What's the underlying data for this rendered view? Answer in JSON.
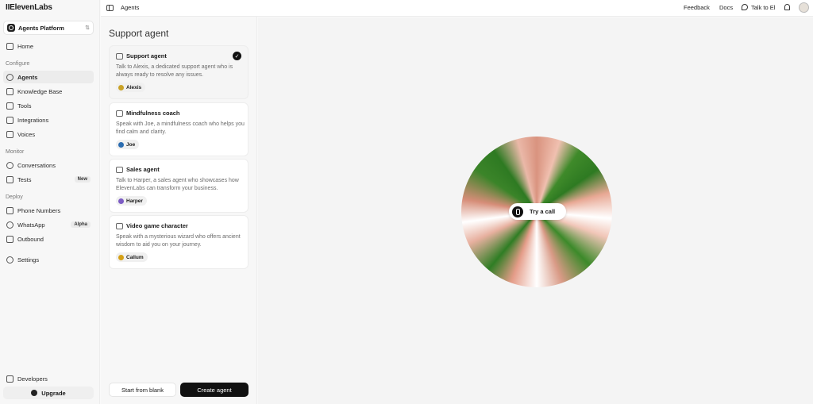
{
  "app": {
    "logo": "IIElevenLabs",
    "platform": "Agents Platform"
  },
  "sidebar": {
    "home": "Home",
    "configure_label": "Configure",
    "agents": "Agents",
    "knowledge_base": "Knowledge Base",
    "tools": "Tools",
    "integrations": "Integrations",
    "voices": "Voices",
    "monitor_label": "Monitor",
    "conversations": "Conversations",
    "tests": "Tests",
    "tests_badge": "New",
    "deploy_label": "Deploy",
    "phone_numbers": "Phone Numbers",
    "whatsapp": "WhatsApp",
    "whatsapp_badge": "Alpha",
    "outbound": "Outbound",
    "settings": "Settings",
    "developers": "Developers",
    "upgrade": "Upgrade"
  },
  "topbar": {
    "breadcrumb": "Agents",
    "feedback": "Feedback",
    "docs": "Docs",
    "talk": "Talk to El"
  },
  "panel": {
    "title": "Support agent",
    "cards": [
      {
        "title": "Support agent",
        "desc": "Talk to Alexis, a dedicated support agent who is always ready to resolve any issues.",
        "voice": "Alexis",
        "voice_color": "#c9a227"
      },
      {
        "title": "Mindfulness coach",
        "desc": "Speak with Joe, a mindfulness coach who helps you find calm and clarity.",
        "voice": "Joe",
        "voice_color": "#2b6cb0"
      },
      {
        "title": "Sales agent",
        "desc": "Talk to Harper, a sales agent who showcases how ElevenLabs can transform your business.",
        "voice": "Harper",
        "voice_color": "#7c5cc4"
      },
      {
        "title": "Video game character",
        "desc": "Speak with a mysterious wizard who offers ancient wisdom to aid you on your journey.",
        "voice": "Callum",
        "voice_color": "#d4a017"
      }
    ],
    "start_blank": "Start from blank",
    "create_agent": "Create agent"
  },
  "stage": {
    "call_label": "Try a call"
  }
}
